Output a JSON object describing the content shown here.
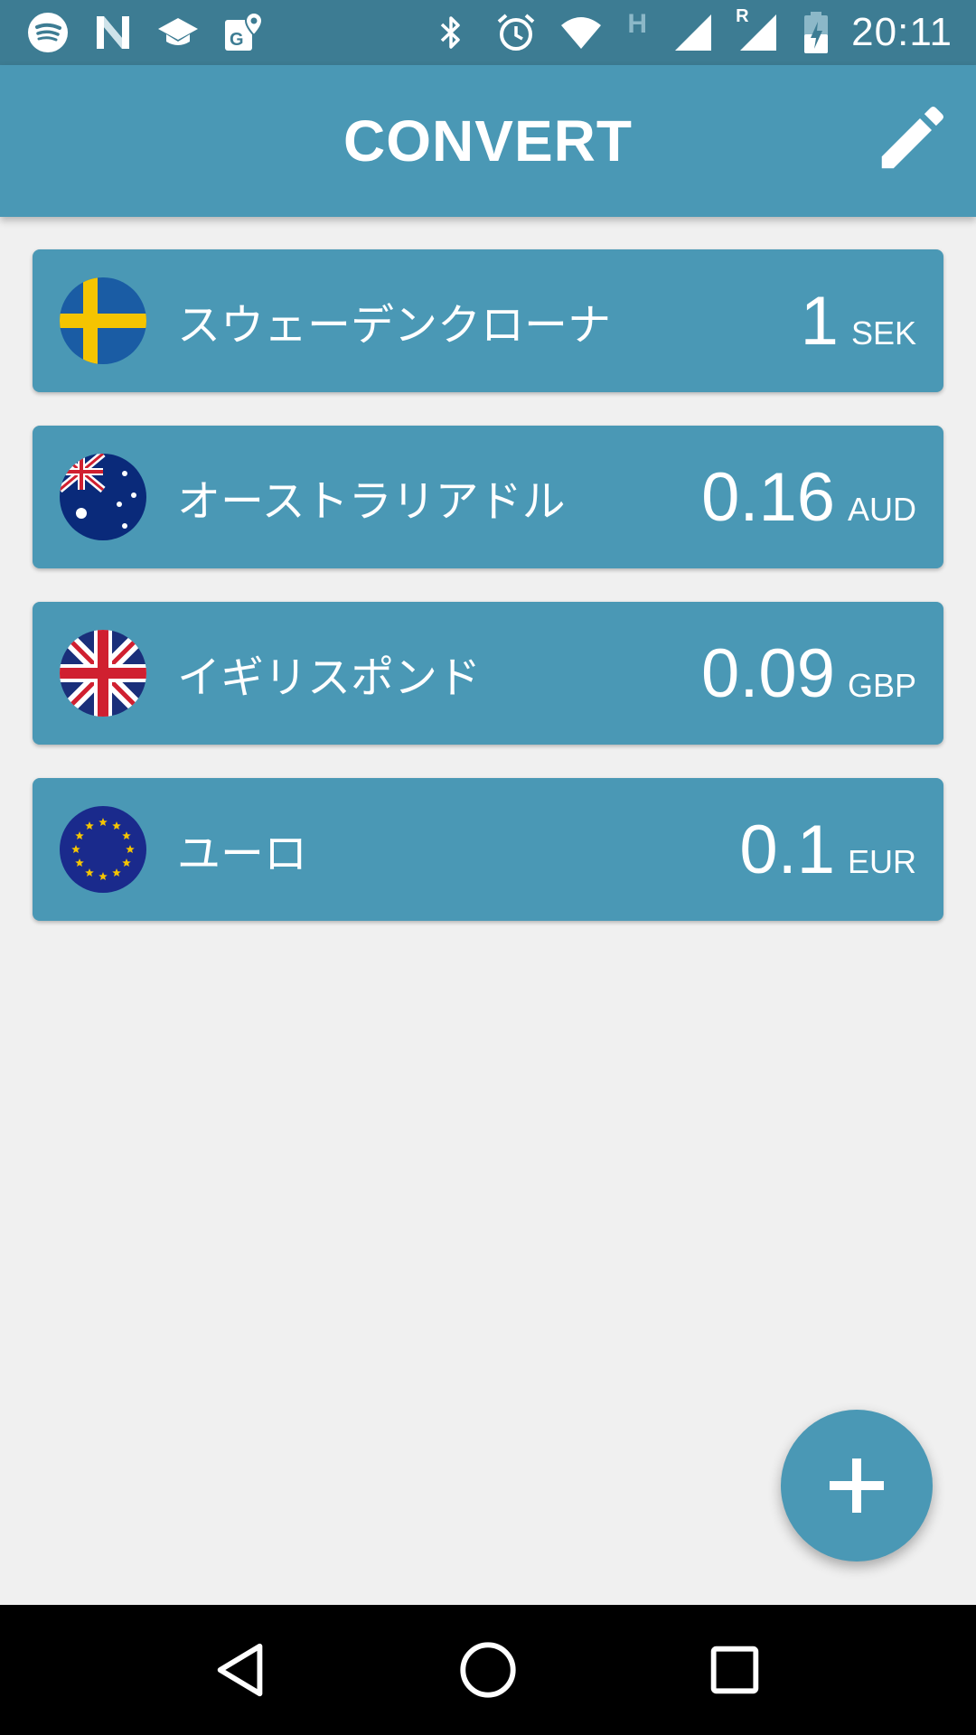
{
  "status_bar": {
    "time": "20:11",
    "left_icons": [
      "spotify-icon",
      "n-app-icon",
      "graduation-cap-icon",
      "maps-icon"
    ],
    "right_icons": [
      "bluetooth-icon",
      "alarm-icon",
      "wifi-icon",
      "h-network-icon",
      "signal-icon",
      "signal-roaming-icon",
      "battery-charging-icon"
    ],
    "network_label": "H",
    "roaming_label": "R"
  },
  "app_bar": {
    "title": "CONVERT",
    "edit_icon": "pencil-icon"
  },
  "currencies": [
    {
      "name": "スウェーデンクローナ",
      "amount": "1",
      "code": "SEK",
      "flag": "sweden-flag-icon"
    },
    {
      "name": "オーストラリアドル",
      "amount": "0.16",
      "code": "AUD",
      "flag": "australia-flag-icon"
    },
    {
      "name": "イギリスポンド",
      "amount": "0.09",
      "code": "GBP",
      "flag": "uk-flag-icon"
    },
    {
      "name": "ユーロ",
      "amount": "0.1",
      "code": "EUR",
      "flag": "eu-flag-icon"
    }
  ],
  "fab": {
    "icon": "plus-icon"
  },
  "nav_bar": {
    "icons": [
      "back-icon",
      "home-icon",
      "recents-icon"
    ]
  },
  "colors": {
    "status_bar": "#3d7c93",
    "primary": "#4a98b5",
    "background": "#f0f0f0"
  }
}
